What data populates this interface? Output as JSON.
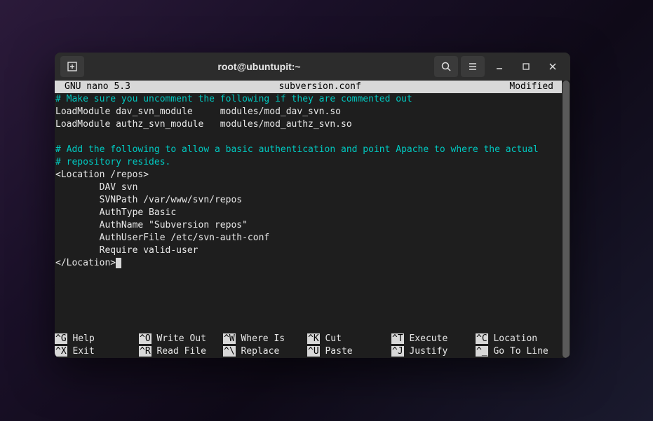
{
  "titlebar": {
    "title": "root@ubuntupit:~"
  },
  "nano": {
    "app": "  GNU nano 5.3",
    "filename": "subversion.conf",
    "status": "Modified"
  },
  "editor": {
    "lines": [
      {
        "cls": "comment",
        "text": "# Make sure you uncomment the following if they are commented out"
      },
      {
        "cls": "",
        "text": "LoadModule dav_svn_module     modules/mod_dav_svn.so"
      },
      {
        "cls": "",
        "text": "LoadModule authz_svn_module   modules/mod_authz_svn.so"
      },
      {
        "cls": "",
        "text": ""
      },
      {
        "cls": "comment",
        "text": "# Add the following to allow a basic authentication and point Apache to where the actual"
      },
      {
        "cls": "comment",
        "text": "# repository resides."
      },
      {
        "cls": "",
        "text": "<Location /repos>"
      },
      {
        "cls": "",
        "text": "        DAV svn"
      },
      {
        "cls": "",
        "text": "        SVNPath /var/www/svn/repos"
      },
      {
        "cls": "",
        "text": "        AuthType Basic"
      },
      {
        "cls": "",
        "text": "        AuthName \"Subversion repos\""
      },
      {
        "cls": "",
        "text": "        AuthUserFile /etc/svn-auth-conf"
      },
      {
        "cls": "",
        "text": "        Require valid-user"
      },
      {
        "cls": "",
        "text": "</Location>",
        "cursor": true
      }
    ]
  },
  "footer": {
    "rows": [
      [
        {
          "key": "^G",
          "label": " Help"
        },
        {
          "key": "^O",
          "label": " Write Out"
        },
        {
          "key": "^W",
          "label": " Where Is"
        },
        {
          "key": "^K",
          "label": " Cut"
        },
        {
          "key": "^T",
          "label": " Execute"
        },
        {
          "key": "^C",
          "label": " Location"
        }
      ],
      [
        {
          "key": "^X",
          "label": " Exit"
        },
        {
          "key": "^R",
          "label": " Read File"
        },
        {
          "key": "^\\",
          "label": " Replace"
        },
        {
          "key": "^U",
          "label": " Paste"
        },
        {
          "key": "^J",
          "label": " Justify"
        },
        {
          "key": "^_",
          "label": " Go To Line"
        }
      ]
    ]
  }
}
